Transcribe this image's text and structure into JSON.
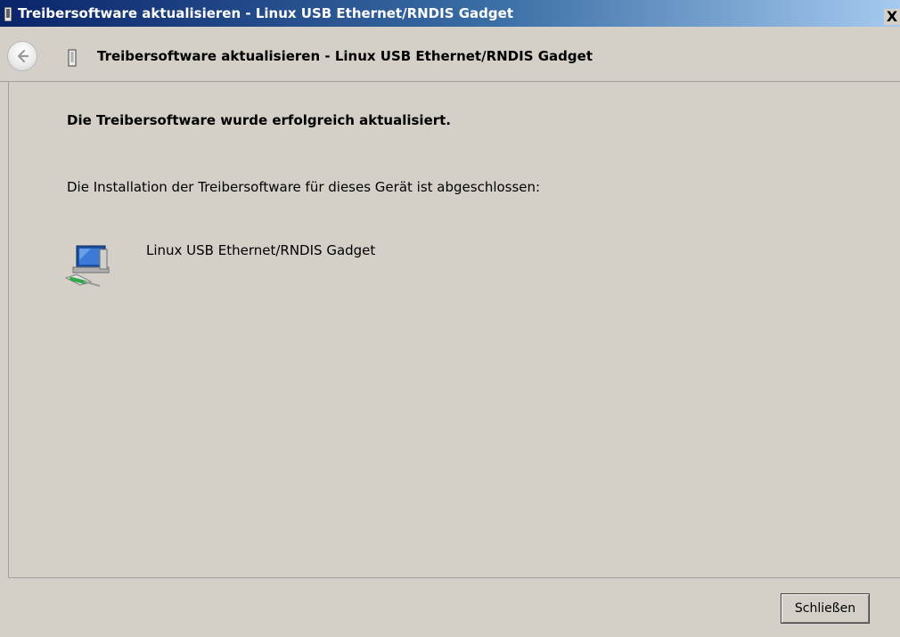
{
  "window": {
    "title": "Treibersoftware aktualisieren - Linux USB Ethernet/RNDIS Gadget",
    "close_glyph": "X"
  },
  "navbar": {
    "title": "Treibersoftware aktualisieren - Linux USB Ethernet/RNDIS Gadget",
    "back_icon": "back-arrow-icon",
    "device_icon": "usb-device-icon"
  },
  "content": {
    "heading": "Die Treibersoftware wurde erfolgreich aktualisiert.",
    "message": "Die Installation der Treibersoftware für dieses Gerät ist abgeschlossen:",
    "device_name": "Linux USB Ethernet/RNDIS Gadget",
    "device_icon": "network-adapter-icon"
  },
  "footer": {
    "close_button_label": "Schließen"
  },
  "colors": {
    "titlebar_start": "#0a246a",
    "titlebar_end": "#a6caf0",
    "dialog_bg": "#d4d0c8"
  }
}
